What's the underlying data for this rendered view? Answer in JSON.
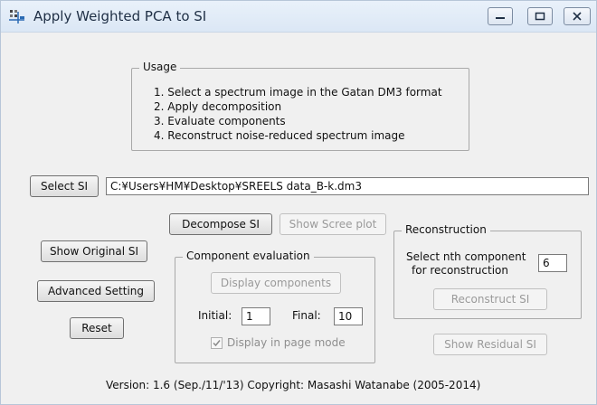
{
  "window": {
    "title": "Apply Weighted PCA to SI",
    "controls": {
      "minimize": "minimize",
      "maximize": "maximize",
      "close": "close"
    }
  },
  "usage": {
    "label": "Usage",
    "steps": [
      "1. Select a spectrum image in the Gatan DM3 format",
      "2. Apply decomposition",
      "3. Evaluate components",
      "4. Reconstruct noise-reduced spectrum image"
    ]
  },
  "select_si": {
    "button_label": "Select SI",
    "path_value": "C:¥Users¥HM¥Desktop¥SREELS data_B-k.dm3"
  },
  "actions": {
    "decompose": "Decompose SI",
    "scree": "Show Scree plot",
    "show_original": "Show Original SI",
    "advanced": "Advanced Setting",
    "reset": "Reset",
    "show_residual": "Show Residual SI"
  },
  "component_evaluation": {
    "label": "Component evaluation",
    "display_button": "Display components",
    "initial_label": "Initial:",
    "initial_value": "1",
    "final_label": "Final:",
    "final_value": "10",
    "page_mode_label": "Display in page mode",
    "page_mode_checked": true
  },
  "reconstruction": {
    "label": "Reconstruction",
    "select_line1": "Select nth component",
    "select_line2": "for reconstruction",
    "nth_value": "6",
    "button": "Reconstruct SI"
  },
  "footer": {
    "version": "Version: 1.6 (Sep./11/'13) Copyright: Masashi Watanabe (2005-2014)"
  }
}
